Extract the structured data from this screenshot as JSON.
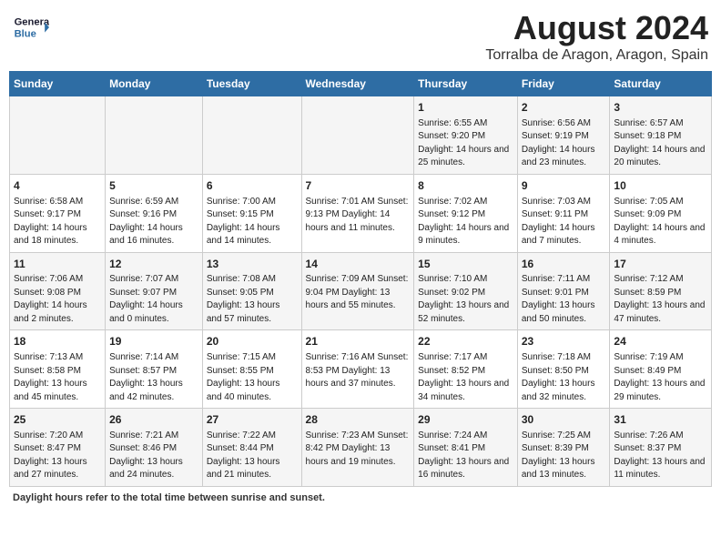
{
  "header": {
    "logo_line1": "General",
    "logo_line2": "Blue",
    "main_title": "August 2024",
    "sub_title": "Torralba de Aragon, Aragon, Spain"
  },
  "days_of_week": [
    "Sunday",
    "Monday",
    "Tuesday",
    "Wednesday",
    "Thursday",
    "Friday",
    "Saturday"
  ],
  "weeks": [
    [
      {
        "num": "",
        "info": ""
      },
      {
        "num": "",
        "info": ""
      },
      {
        "num": "",
        "info": ""
      },
      {
        "num": "",
        "info": ""
      },
      {
        "num": "1",
        "info": "Sunrise: 6:55 AM\nSunset: 9:20 PM\nDaylight: 14 hours\nand 25 minutes."
      },
      {
        "num": "2",
        "info": "Sunrise: 6:56 AM\nSunset: 9:19 PM\nDaylight: 14 hours\nand 23 minutes."
      },
      {
        "num": "3",
        "info": "Sunrise: 6:57 AM\nSunset: 9:18 PM\nDaylight: 14 hours\nand 20 minutes."
      }
    ],
    [
      {
        "num": "4",
        "info": "Sunrise: 6:58 AM\nSunset: 9:17 PM\nDaylight: 14 hours\nand 18 minutes."
      },
      {
        "num": "5",
        "info": "Sunrise: 6:59 AM\nSunset: 9:16 PM\nDaylight: 14 hours\nand 16 minutes."
      },
      {
        "num": "6",
        "info": "Sunrise: 7:00 AM\nSunset: 9:15 PM\nDaylight: 14 hours\nand 14 minutes."
      },
      {
        "num": "7",
        "info": "Sunrise: 7:01 AM\nSunset: 9:13 PM\nDaylight: 14 hours\nand 11 minutes."
      },
      {
        "num": "8",
        "info": "Sunrise: 7:02 AM\nSunset: 9:12 PM\nDaylight: 14 hours\nand 9 minutes."
      },
      {
        "num": "9",
        "info": "Sunrise: 7:03 AM\nSunset: 9:11 PM\nDaylight: 14 hours\nand 7 minutes."
      },
      {
        "num": "10",
        "info": "Sunrise: 7:05 AM\nSunset: 9:09 PM\nDaylight: 14 hours\nand 4 minutes."
      }
    ],
    [
      {
        "num": "11",
        "info": "Sunrise: 7:06 AM\nSunset: 9:08 PM\nDaylight: 14 hours\nand 2 minutes."
      },
      {
        "num": "12",
        "info": "Sunrise: 7:07 AM\nSunset: 9:07 PM\nDaylight: 14 hours\nand 0 minutes."
      },
      {
        "num": "13",
        "info": "Sunrise: 7:08 AM\nSunset: 9:05 PM\nDaylight: 13 hours\nand 57 minutes."
      },
      {
        "num": "14",
        "info": "Sunrise: 7:09 AM\nSunset: 9:04 PM\nDaylight: 13 hours\nand 55 minutes."
      },
      {
        "num": "15",
        "info": "Sunrise: 7:10 AM\nSunset: 9:02 PM\nDaylight: 13 hours\nand 52 minutes."
      },
      {
        "num": "16",
        "info": "Sunrise: 7:11 AM\nSunset: 9:01 PM\nDaylight: 13 hours\nand 50 minutes."
      },
      {
        "num": "17",
        "info": "Sunrise: 7:12 AM\nSunset: 8:59 PM\nDaylight: 13 hours\nand 47 minutes."
      }
    ],
    [
      {
        "num": "18",
        "info": "Sunrise: 7:13 AM\nSunset: 8:58 PM\nDaylight: 13 hours\nand 45 minutes."
      },
      {
        "num": "19",
        "info": "Sunrise: 7:14 AM\nSunset: 8:57 PM\nDaylight: 13 hours\nand 42 minutes."
      },
      {
        "num": "20",
        "info": "Sunrise: 7:15 AM\nSunset: 8:55 PM\nDaylight: 13 hours\nand 40 minutes."
      },
      {
        "num": "21",
        "info": "Sunrise: 7:16 AM\nSunset: 8:53 PM\nDaylight: 13 hours\nand 37 minutes."
      },
      {
        "num": "22",
        "info": "Sunrise: 7:17 AM\nSunset: 8:52 PM\nDaylight: 13 hours\nand 34 minutes."
      },
      {
        "num": "23",
        "info": "Sunrise: 7:18 AM\nSunset: 8:50 PM\nDaylight: 13 hours\nand 32 minutes."
      },
      {
        "num": "24",
        "info": "Sunrise: 7:19 AM\nSunset: 8:49 PM\nDaylight: 13 hours\nand 29 minutes."
      }
    ],
    [
      {
        "num": "25",
        "info": "Sunrise: 7:20 AM\nSunset: 8:47 PM\nDaylight: 13 hours\nand 27 minutes."
      },
      {
        "num": "26",
        "info": "Sunrise: 7:21 AM\nSunset: 8:46 PM\nDaylight: 13 hours\nand 24 minutes."
      },
      {
        "num": "27",
        "info": "Sunrise: 7:22 AM\nSunset: 8:44 PM\nDaylight: 13 hours\nand 21 minutes."
      },
      {
        "num": "28",
        "info": "Sunrise: 7:23 AM\nSunset: 8:42 PM\nDaylight: 13 hours\nand 19 minutes."
      },
      {
        "num": "29",
        "info": "Sunrise: 7:24 AM\nSunset: 8:41 PM\nDaylight: 13 hours\nand 16 minutes."
      },
      {
        "num": "30",
        "info": "Sunrise: 7:25 AM\nSunset: 8:39 PM\nDaylight: 13 hours\nand 13 minutes."
      },
      {
        "num": "31",
        "info": "Sunrise: 7:26 AM\nSunset: 8:37 PM\nDaylight: 13 hours\nand 11 minutes."
      }
    ]
  ],
  "footer": {
    "label": "Daylight hours",
    "description": " refer to the total time between sunrise and sunset."
  }
}
